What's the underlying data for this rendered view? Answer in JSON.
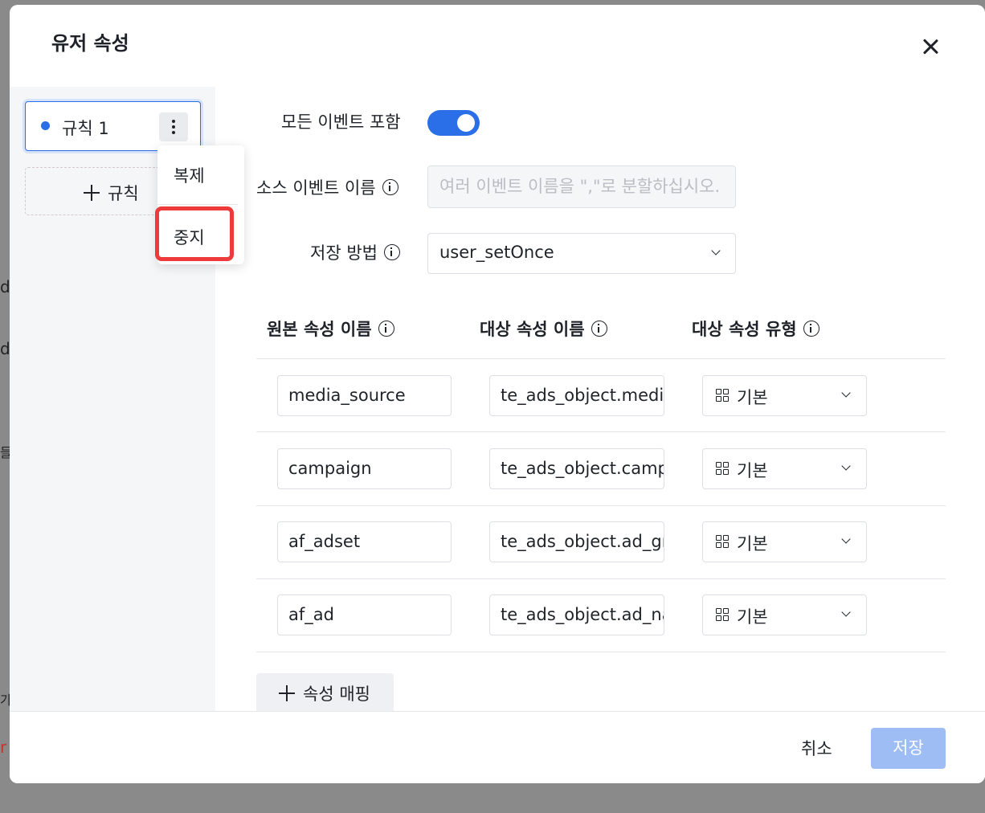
{
  "modal": {
    "title": "유저 속성"
  },
  "sidebar": {
    "rule_label": "규칙 1",
    "add_rule_label": "규칙",
    "menu": {
      "copy": "복제",
      "stop": "중지"
    }
  },
  "form": {
    "include_all_label": "모든 이벤트 포함",
    "include_all_on": true,
    "source_event_label": "소스 이벤트 이름",
    "source_event_placeholder": "여러 이벤트 이름을 \",\"로 분할하십시오.",
    "storage_label": "저장 방법",
    "storage_value": "user_setOnce"
  },
  "table": {
    "headers": [
      "원본 속성 이름",
      "대상 속성 이름",
      "대상 속성 유형"
    ],
    "rows": [
      {
        "source": "media_source",
        "target": "te_ads_object.media_source",
        "type": "기본"
      },
      {
        "source": "campaign",
        "target": "te_ads_object.campaign",
        "type": "기본"
      },
      {
        "source": "af_adset",
        "target": "te_ads_object.ad_group",
        "type": "기본"
      },
      {
        "source": "af_ad",
        "target": "te_ads_object.ad_name",
        "type": "기본"
      }
    ]
  },
  "add_mapping_label": "속성 매핑",
  "footer": {
    "cancel": "취소",
    "save": "저장"
  },
  "background": {
    "fragments": [
      "d",
      "d",
      "들",
      "가",
      "r"
    ]
  }
}
